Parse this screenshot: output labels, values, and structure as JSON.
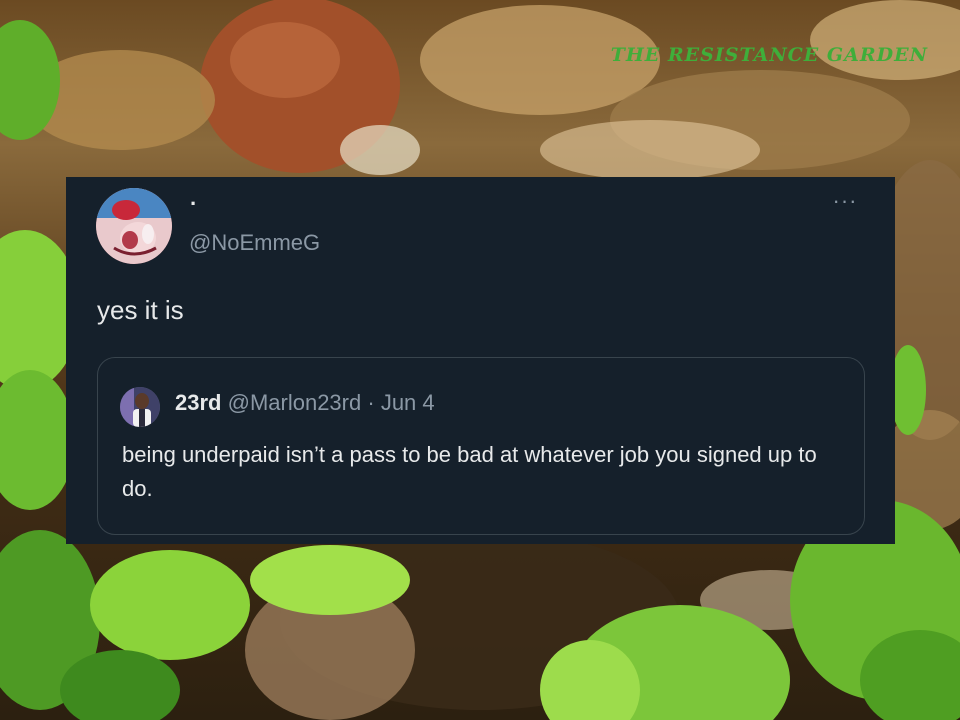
{
  "watermark": "THE RESISTANCE GARDEN",
  "tweet": {
    "display_name": "·",
    "handle": "@NoEmmeG",
    "more_icon": "···",
    "text": "yes it is",
    "quoted": {
      "name": "23rd",
      "handle": "@Marlon23rd",
      "separator": "·",
      "date": "Jun 4",
      "text": "being underpaid isn’t a pass to be bad at whatever job you signed up to do."
    }
  },
  "colors": {
    "card_bg": "#15202b",
    "text_primary": "#e7e9ea",
    "text_secondary": "#8b98a5",
    "quote_border": "#38444d",
    "watermark": "#3fae3a"
  }
}
